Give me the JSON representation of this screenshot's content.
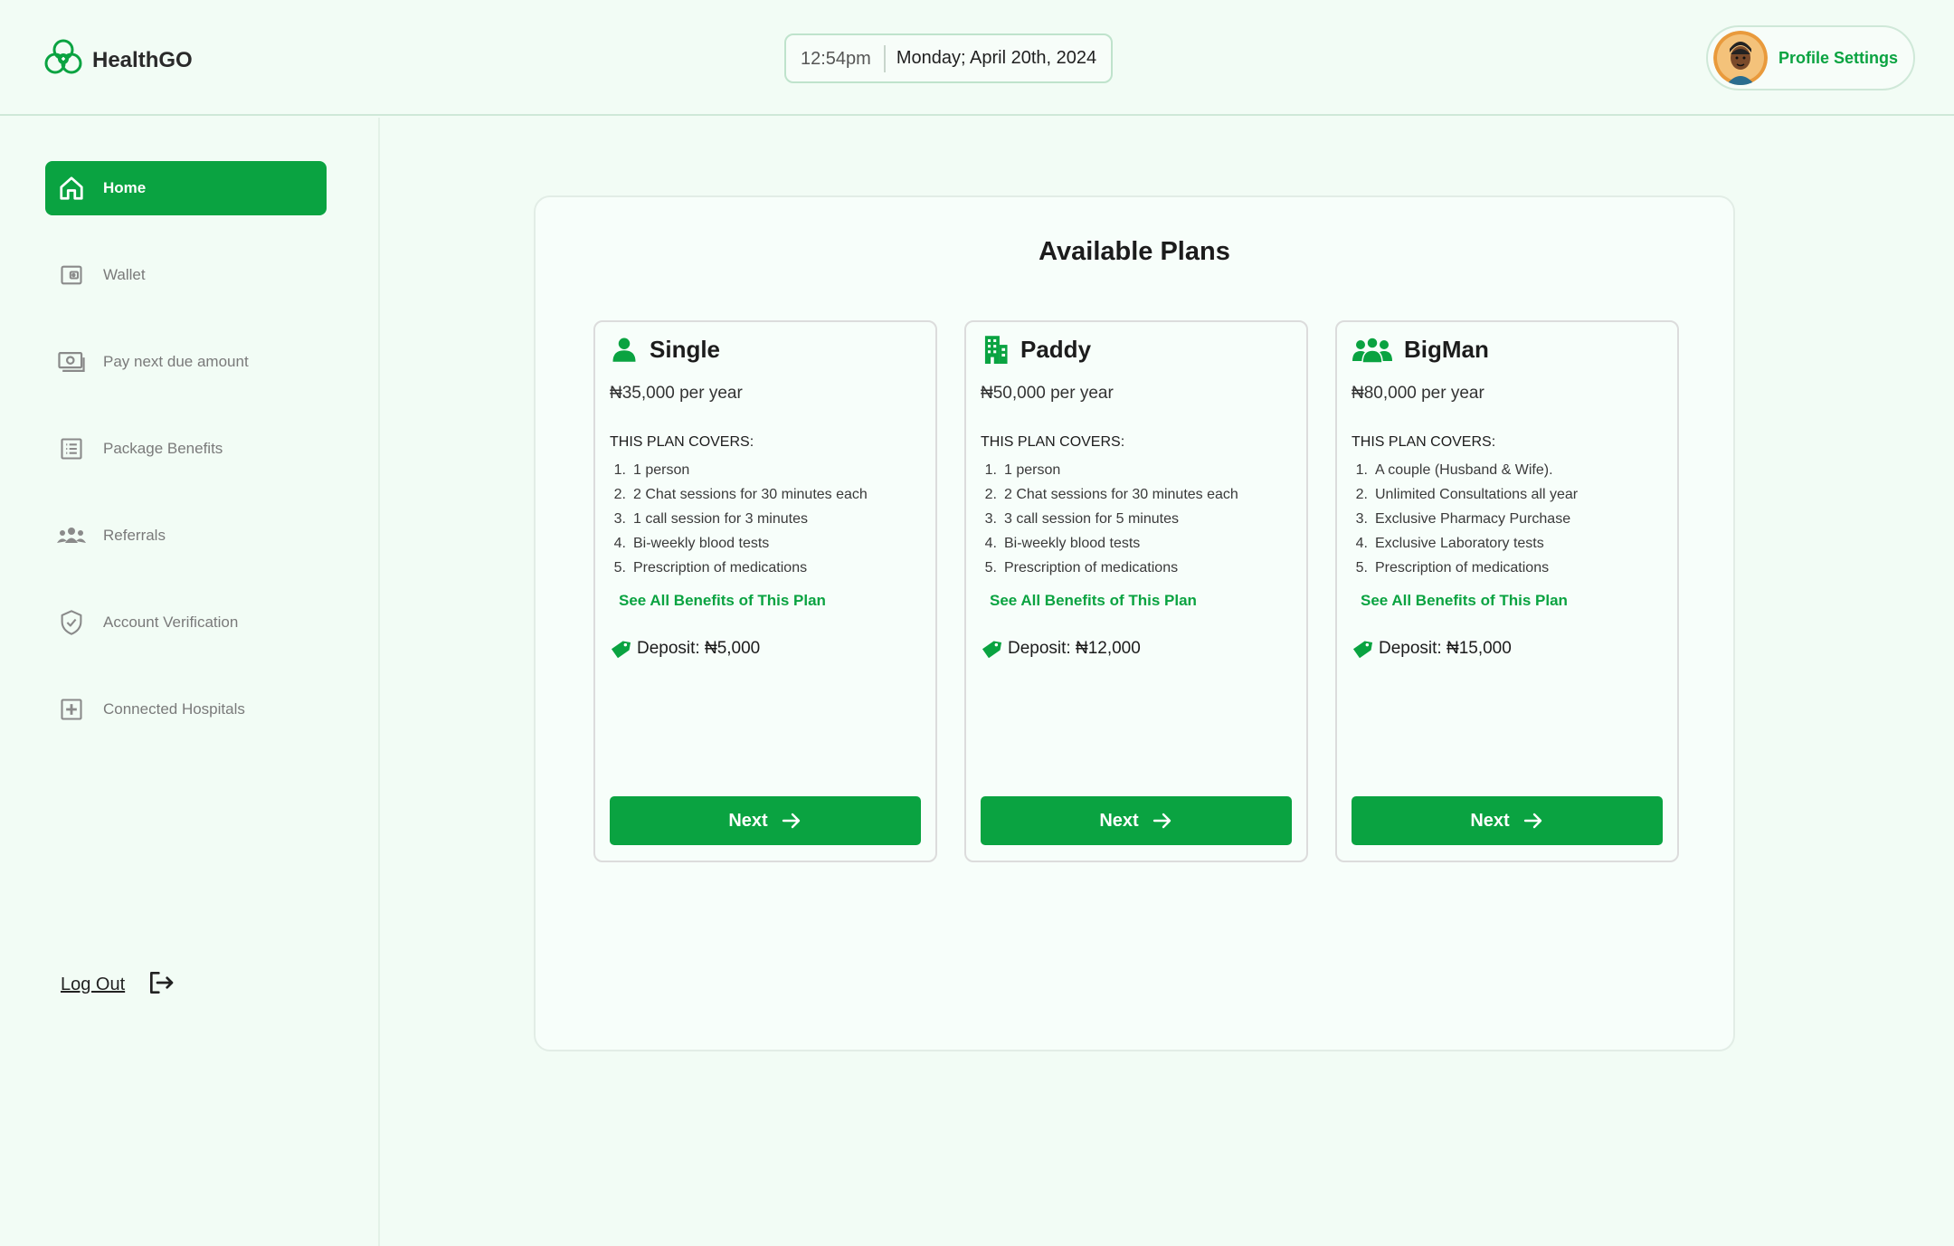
{
  "app": {
    "name": "HealthGO",
    "brand_color": "#0aa341"
  },
  "header": {
    "time": "12:54pm",
    "date": "Monday; April 20th, 2024",
    "profile_label": "Profile Settings"
  },
  "sidebar": {
    "items": [
      {
        "label": "Home",
        "icon": "home-icon",
        "active": true
      },
      {
        "label": "Wallet",
        "icon": "wallet-icon"
      },
      {
        "label": "Pay next due amount",
        "icon": "cash-icon"
      },
      {
        "label": "Package Benefits",
        "icon": "list-icon"
      },
      {
        "label": "Referrals",
        "icon": "users-icon"
      },
      {
        "label": "Account Verification",
        "icon": "shield-check-icon"
      },
      {
        "label": "Connected Hospitals",
        "icon": "hospital-plus-icon"
      }
    ],
    "logout_label": "Log Out"
  },
  "main": {
    "title": "Available Plans",
    "plans": [
      {
        "name": "Single",
        "icon": "user-icon",
        "price": "₦35,000 per year",
        "covers_label": "THIS PLAN COVERS:",
        "benefits": [
          "1 person",
          "2 Chat sessions for 30 minutes each",
          "1 call session for 3 minutes",
          "Bi-weekly blood tests",
          "Prescription of medications"
        ],
        "see_all": "See All Benefits of This Plan",
        "deposit": "Deposit: ₦5,000",
        "button": "Next"
      },
      {
        "name": "Paddy",
        "icon": "building-icon",
        "price": "₦50,000 per year",
        "covers_label": "THIS PLAN COVERS:",
        "benefits": [
          "1 person",
          "2 Chat sessions for 30 minutes each",
          "3 call session for 5 minutes",
          "Bi-weekly blood tests",
          "Prescription of medications"
        ],
        "see_all": "See All Benefits of This Plan",
        "deposit": "Deposit: ₦12,000",
        "button": "Next"
      },
      {
        "name": "BigMan",
        "icon": "group-icon",
        "price": "₦80,000 per year",
        "covers_label": "THIS PLAN COVERS:",
        "benefits": [
          "A couple (Husband & Wife).",
          "Unlimited Consultations all year",
          "Exclusive Pharmacy Purchase",
          "Exclusive Laboratory tests",
          "Prescription of medications"
        ],
        "see_all": "See All Benefits of This Plan",
        "deposit": "Deposit: ₦15,000",
        "button": "Next"
      }
    ]
  }
}
